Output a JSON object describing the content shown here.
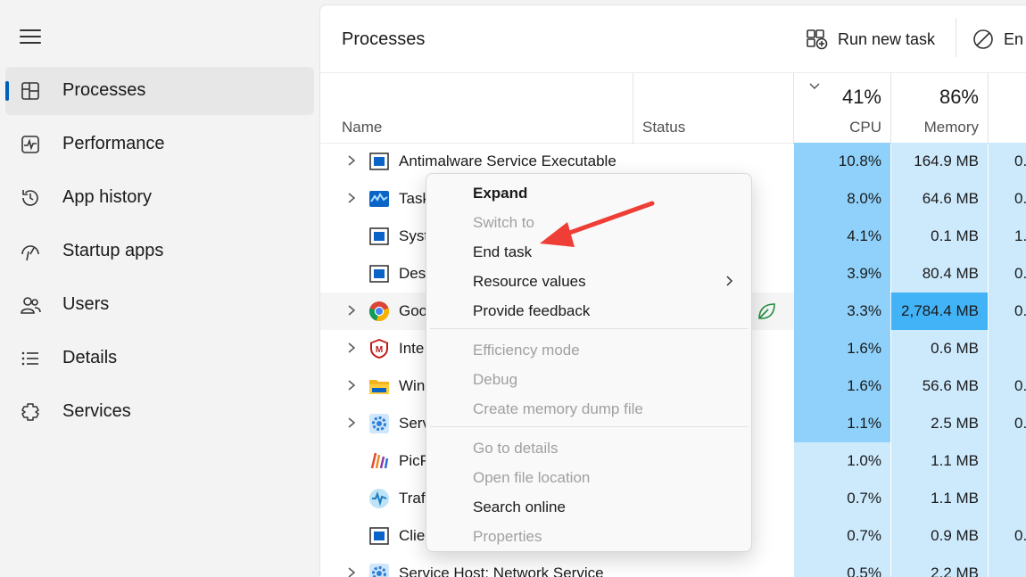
{
  "sidebar": {
    "items": [
      {
        "label": "Processes",
        "icon": "processes-icon",
        "active": true
      },
      {
        "label": "Performance",
        "icon": "performance-icon"
      },
      {
        "label": "App history",
        "icon": "app-history-icon"
      },
      {
        "label": "Startup apps",
        "icon": "startup-apps-icon"
      },
      {
        "label": "Users",
        "icon": "users-icon"
      },
      {
        "label": "Details",
        "icon": "details-icon"
      },
      {
        "label": "Services",
        "icon": "services-icon"
      }
    ]
  },
  "header": {
    "title": "Processes",
    "run_new_task": "Run new task",
    "end_task_truncated": "En"
  },
  "table": {
    "columns": {
      "name": "Name",
      "status": "Status",
      "cpu_pct": "41%",
      "cpu": "CPU",
      "mem_pct": "86%",
      "mem": "Memory"
    },
    "rows": [
      {
        "name": "Antimalware Service Executable",
        "expandable": true,
        "icon": "app-window-icon",
        "cpu": "10.8%",
        "mem": "164.9 MB",
        "extra": "0."
      },
      {
        "name": "Task",
        "expandable": true,
        "icon": "task-manager-icon",
        "cpu": "8.0%",
        "mem": "64.6 MB",
        "extra": "0."
      },
      {
        "name": "Syst",
        "expandable": false,
        "icon": "app-window-icon",
        "cpu": "4.1%",
        "mem": "0.1 MB",
        "extra": "1."
      },
      {
        "name": "Des",
        "expandable": false,
        "icon": "app-window-icon",
        "cpu": "3.9%",
        "mem": "80.4 MB",
        "extra": "0."
      },
      {
        "name": "Goo",
        "expandable": true,
        "icon": "chrome-icon",
        "cpu": "3.3%",
        "mem": "2,784.4 MB",
        "extra": "0.",
        "efficiency": true
      },
      {
        "name": "Inte",
        "expandable": true,
        "icon": "mcafee-icon",
        "cpu": "1.6%",
        "mem": "0.6 MB",
        "extra": ""
      },
      {
        "name": "Win",
        "expandable": true,
        "icon": "folder-icon",
        "cpu": "1.6%",
        "mem": "56.6 MB",
        "extra": "0."
      },
      {
        "name": "Serv",
        "expandable": true,
        "icon": "gear-icon",
        "cpu": "1.1%",
        "mem": "2.5 MB",
        "extra": "0."
      },
      {
        "name": "PicP",
        "expandable": false,
        "icon": "picpick-icon",
        "cpu": "1.0%",
        "mem": "1.1 MB",
        "extra": ""
      },
      {
        "name": "Traf",
        "expandable": false,
        "icon": "traffic-monitor-icon",
        "cpu": "0.7%",
        "mem": "1.1 MB",
        "extra": ""
      },
      {
        "name": "Clie",
        "expandable": false,
        "icon": "app-window-icon",
        "cpu": "0.7%",
        "mem": "0.9 MB",
        "extra": "0."
      },
      {
        "name": "Service Host: Network Service",
        "expandable": true,
        "icon": "gear-icon",
        "cpu": "0.5%",
        "mem": "2.2 MB",
        "extra": ""
      }
    ]
  },
  "context_menu": {
    "items": [
      {
        "label": "Expand",
        "bold": true,
        "disabled": false
      },
      {
        "label": "Switch to",
        "disabled": true
      },
      {
        "label": "End task",
        "disabled": false
      },
      {
        "label": "Resource values",
        "disabled": false,
        "submenu": true
      },
      {
        "label": "Provide feedback",
        "disabled": false
      },
      {
        "label": "Efficiency mode",
        "disabled": true
      },
      {
        "label": "Debug",
        "disabled": true
      },
      {
        "label": "Create memory dump file",
        "disabled": true
      },
      {
        "label": "Go to details",
        "disabled": true
      },
      {
        "label": "Open file location",
        "disabled": true
      },
      {
        "label": "Search online",
        "disabled": false
      },
      {
        "label": "Properties",
        "disabled": true
      }
    ]
  },
  "colors": {
    "cpu_high": "#8fd1fa",
    "cpu_low": "#cdeafd",
    "mem_high": "#42b3f7",
    "mem_normal": "#cdeafd",
    "annotation_arrow": "#ef3e36"
  }
}
